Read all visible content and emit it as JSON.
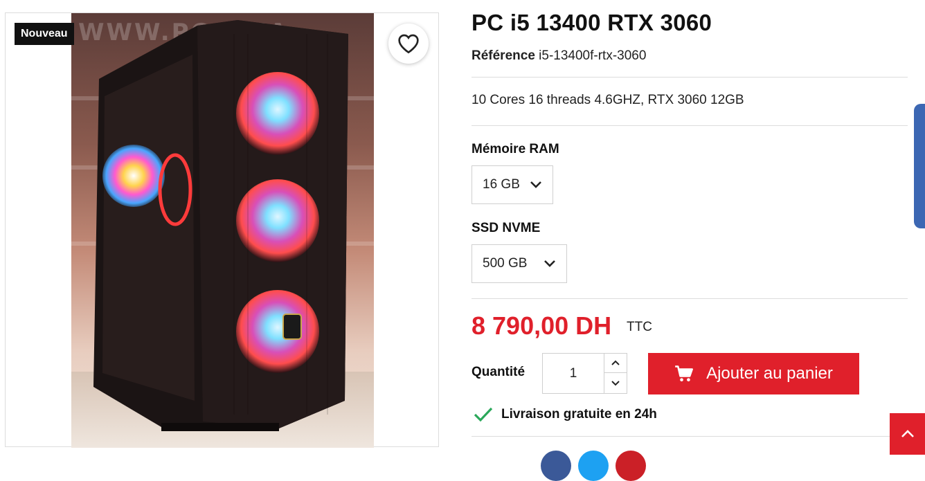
{
  "product": {
    "badge": "Nouveau",
    "title": "PC i5 13400 RTX 3060",
    "reference_label": "Référence",
    "reference_value": "i5-13400f-rtx-3060",
    "description": "10 Cores 16 threads 4.6GHZ, RTX 3060 12GB",
    "image_watermark": "WWW.PC...MA"
  },
  "options": {
    "ram_label": "Mémoire RAM",
    "ram_value": "16 GB",
    "ssd_label": "SSD NVME",
    "ssd_value": "500 GB"
  },
  "pricing": {
    "price": "8 790,00 DH",
    "tax_label": "TTC"
  },
  "purchase": {
    "quantity_label": "Quantité",
    "quantity_value": "1",
    "add_to_cart_label": "Ajouter au panier"
  },
  "delivery": {
    "text": "Livraison gratuite en 24h"
  },
  "icons": {
    "favorite": "heart-icon",
    "cart": "cart-icon",
    "check": "check-icon",
    "chevron": "chevron-down-icon",
    "back_to_top": "chevron-up-icon"
  },
  "colors": {
    "accent": "#e0202b",
    "check": "#2aa85a",
    "share_facebook": "#3b5998",
    "share_twitter": "#1da1f2",
    "share_pinterest": "#cb2027"
  }
}
